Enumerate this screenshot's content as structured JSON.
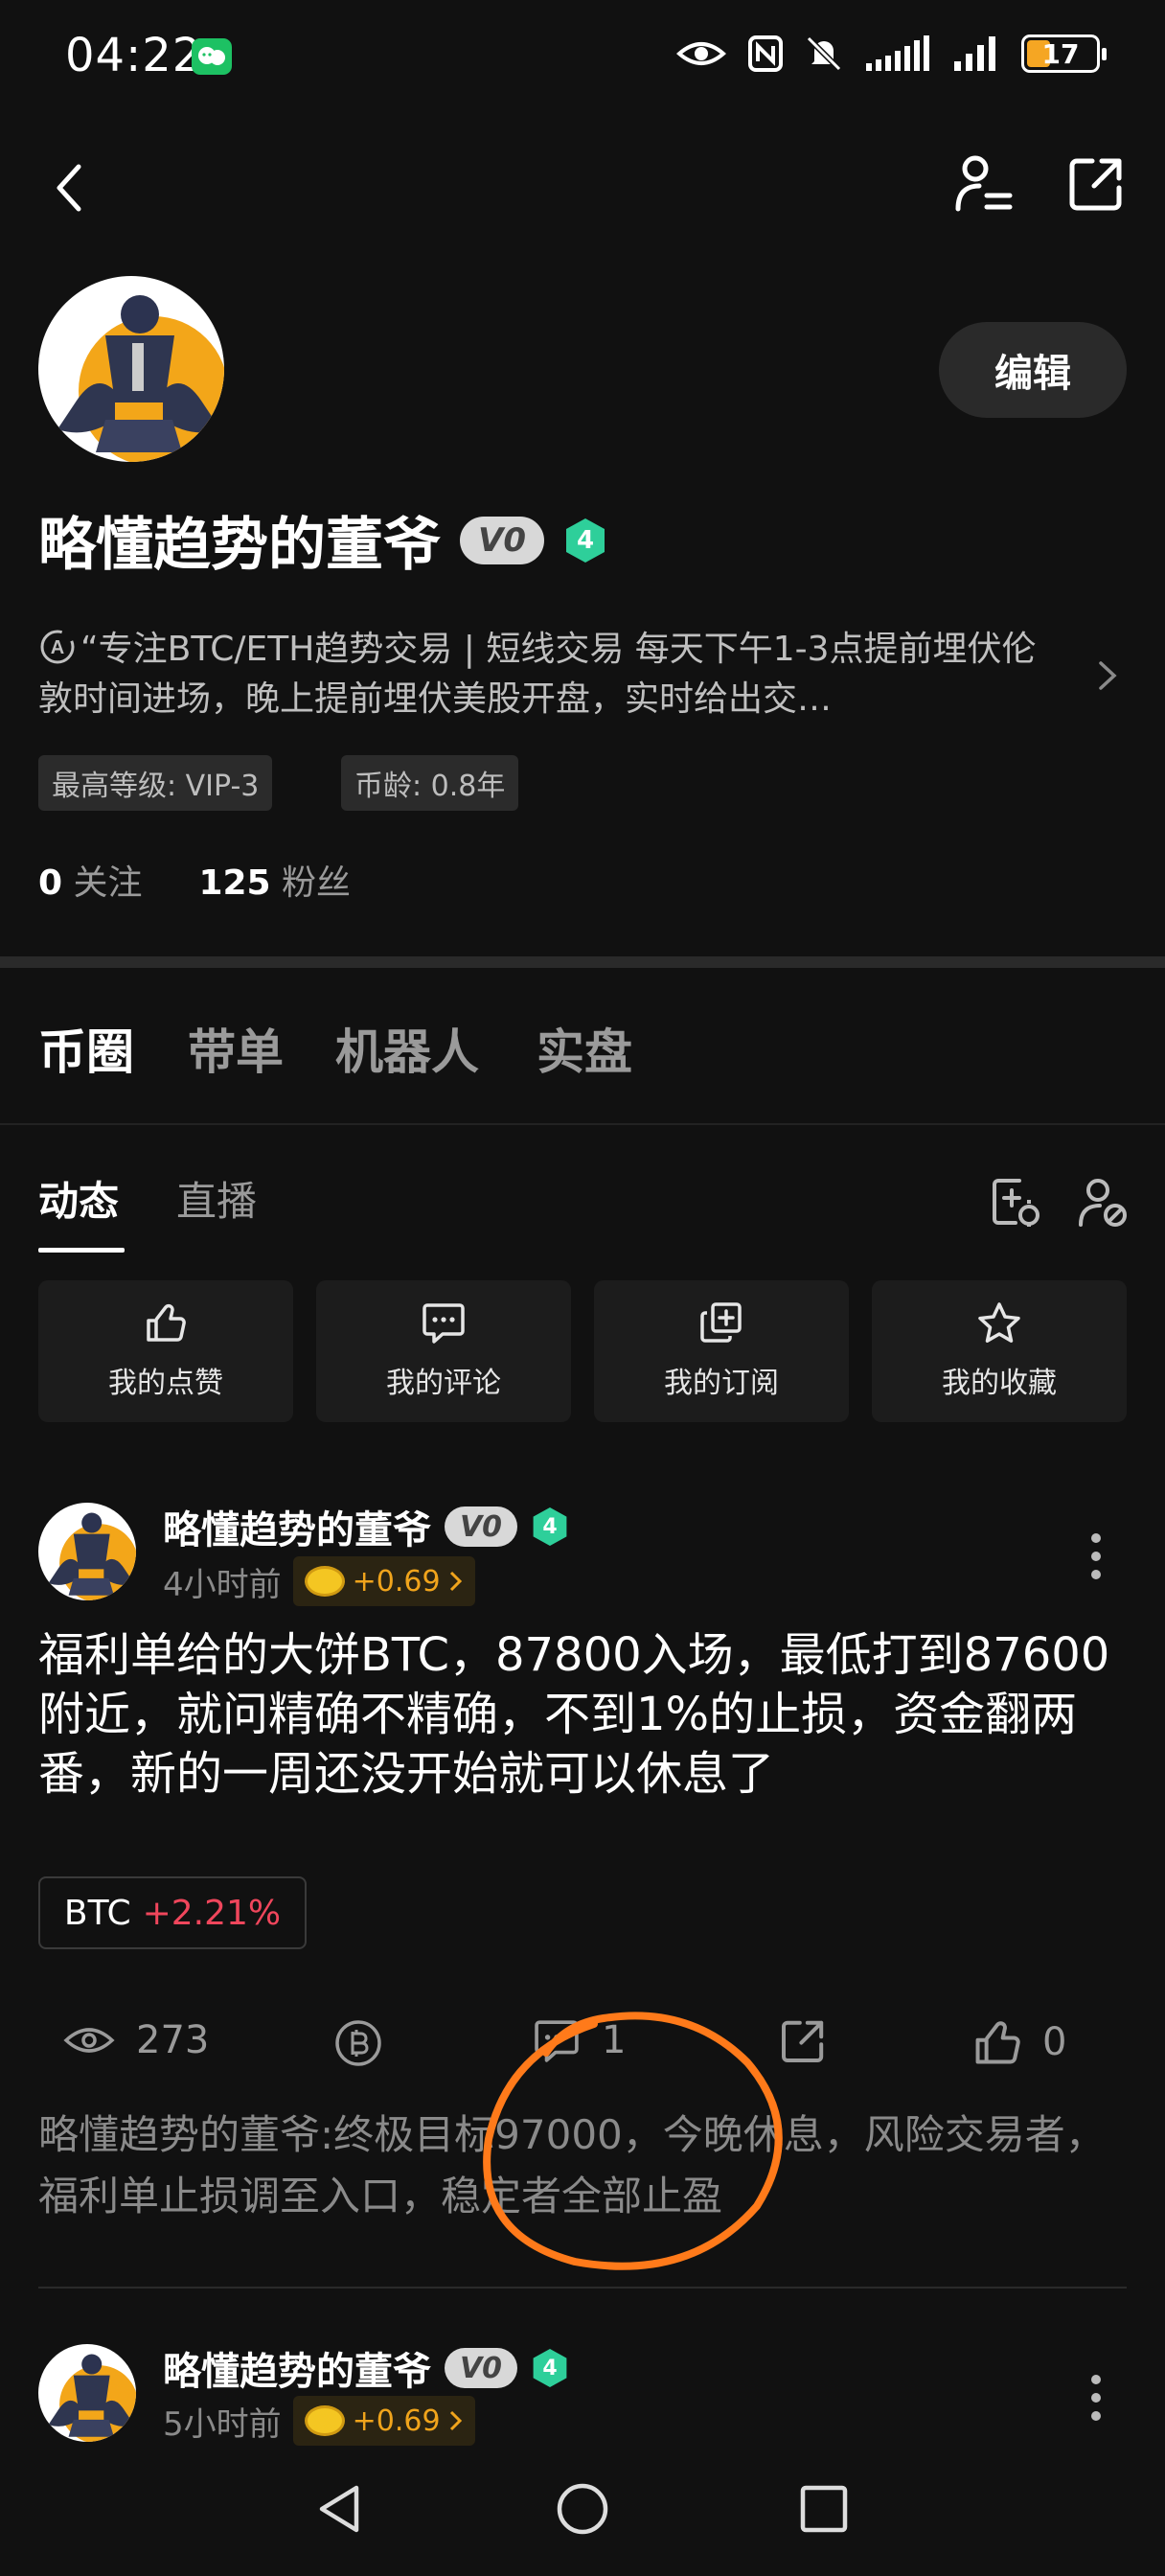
{
  "status_bar": {
    "time": "04:22",
    "battery": "17"
  },
  "profile": {
    "name": "略懂趋势的董爷",
    "vip_badge": "V0",
    "level": "4",
    "edit_label": "编辑",
    "bio": "“专注BTC/ETH趋势交易 | 短线交易 每天下午1-3点提前埋伏伦敦时间进场，晚上提前埋伏美股开盘，实时给出交…",
    "tags": [
      "最高等级:  VIP-3",
      "币龄:  0.8年"
    ],
    "following_count": "0",
    "following_label": "关注",
    "followers_count": "125",
    "followers_label": "粉丝"
  },
  "main_tabs": [
    "币圈",
    "带单",
    "机器人",
    "实盘"
  ],
  "sub_tabs": [
    "动态",
    "直播"
  ],
  "quick_actions": [
    {
      "icon": "thumbs-up-icon",
      "label": "我的点赞"
    },
    {
      "icon": "comment-icon",
      "label": "我的评论"
    },
    {
      "icon": "subscribe-icon",
      "label": "我的订阅"
    },
    {
      "icon": "star-icon",
      "label": "我的收藏"
    }
  ],
  "posts": [
    {
      "author": "略懂趋势的董爷",
      "badge": "V0",
      "level": "4",
      "time": "4小时前",
      "coin_reward": "+0.69",
      "body": "福利单给的大饼BTC，87800入场，最低打到87600附近，就问精确不精确，不到1%的止损，资金翻两番，新的一周还没开始就可以休息了",
      "coin_tag": {
        "symbol": "BTC",
        "change": "+2.21%"
      },
      "views": "273",
      "comments": "1",
      "likes": "0",
      "comment_preview": "略懂趋势的董爷:终极目标97000，今晚休息，风险交易者，福利单止损调至入口，稳定者全部止盈"
    },
    {
      "author": "略懂趋势的董爷",
      "badge": "V0",
      "level": "4",
      "time": "5小时前",
      "coin_reward": "+0.69"
    }
  ],
  "colors": {
    "background": "#111111",
    "accent_green": "#2ecf9a",
    "positive_red": "#f0465c",
    "coin_gold": "#f0a41c",
    "annotation_orange": "#ff7a1a"
  }
}
